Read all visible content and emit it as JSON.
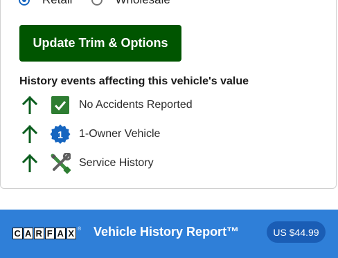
{
  "price_type": {
    "options": [
      {
        "label": "Retail",
        "selected": true
      },
      {
        "label": "Wholesale",
        "selected": false
      }
    ]
  },
  "update_button": {
    "label": "Update Trim & Options"
  },
  "history": {
    "heading": "History events affecting this vehicle's value",
    "events": [
      {
        "label": "No Accidents Reported",
        "icon": "checkbox-check-icon",
        "trend": "up"
      },
      {
        "label": "1-Owner Vehicle",
        "icon": "owner-badge-icon",
        "badge_text": "1",
        "trend": "up"
      },
      {
        "label": "Service History",
        "icon": "wrench-screwdriver-icon",
        "trend": "up"
      }
    ]
  },
  "footer": {
    "logo_letters": [
      "C",
      "A",
      "R",
      "F",
      "A",
      "X"
    ],
    "report_title": "Vehicle History Report™",
    "price": "US $44.99"
  },
  "colors": {
    "primary_green": "#005500",
    "arrow_green": "#0b5d1e",
    "check_green": "#2e7d32",
    "badge_blue": "#1565c0",
    "footer_blue": "#2f7fd8",
    "pill_blue": "#1a5db5"
  }
}
